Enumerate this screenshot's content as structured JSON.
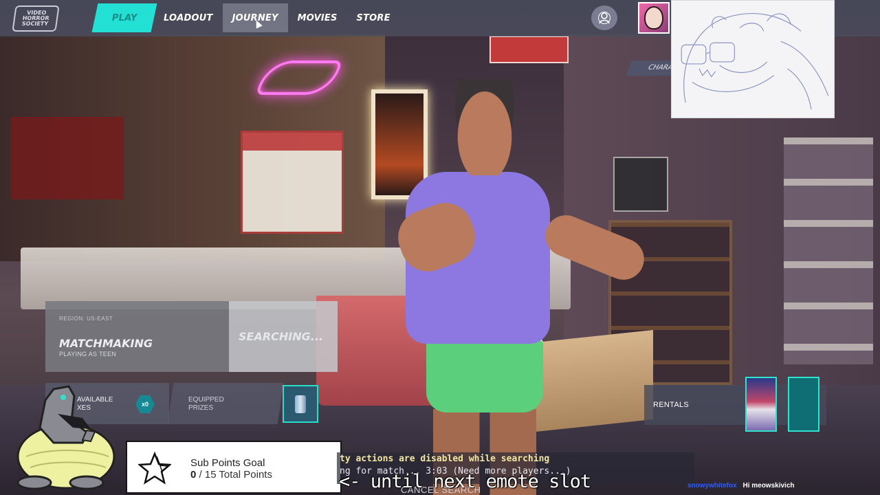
{
  "logo": {
    "line1": "VIDEO",
    "line2": "HORROR",
    "line3": "SOCIETY"
  },
  "nav": {
    "items": [
      {
        "label": "PLAY",
        "state": "active"
      },
      {
        "label": "LOADOUT",
        "state": "normal"
      },
      {
        "label": "JOURNEY",
        "state": "hover"
      },
      {
        "label": "MOVIES",
        "state": "normal"
      },
      {
        "label": "STORE",
        "state": "normal"
      }
    ],
    "character_button_icon": "character-icon",
    "avatar_icon": "profile-avatar"
  },
  "character_tab": {
    "label": "CHARA"
  },
  "matchmaking": {
    "region": "REGION: US-EAST",
    "title": "MATCHMAKING",
    "subtitle": "PLAYING AS TEEN",
    "button_label": "SEARCHING..."
  },
  "lootboxes": {
    "available_label": "AVAILABLE\nXES",
    "available_count": "x0",
    "equipped_label": "EQUIPPED\nPRIZES"
  },
  "rentals": {
    "label": "RENTALS"
  },
  "sub_goal": {
    "title": "Sub Points Goal",
    "current": "0",
    "total_text": "/ 15 Total Points"
  },
  "console": {
    "line1": "ty actions are disabled while searching",
    "line2": "ng for match... 3:03 (Need more players...)",
    "cancel_label": "CANCEL SEARCH"
  },
  "caption": "<- until next emote slot",
  "chat": {
    "user": "snowywhitefox",
    "message": "Hi meowskivich"
  },
  "colors": {
    "accent": "#22e0d4",
    "card_border": "#2fe3cd",
    "chat_user": "#2f5cff",
    "console_warning": "#f2e6a2"
  }
}
